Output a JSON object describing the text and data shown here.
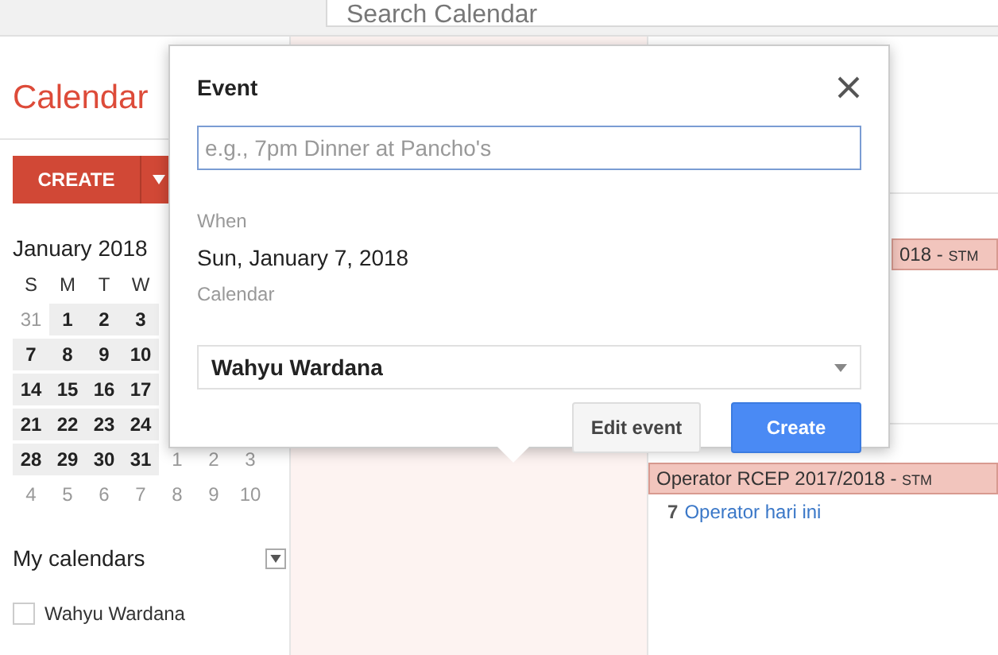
{
  "search": {
    "placeholder": "Search Calendar"
  },
  "sidebar": {
    "title": "Calendar",
    "create_button": "CREATE",
    "mini_calendar": {
      "month": "January 2018",
      "weekdays": [
        "S",
        "M",
        "T",
        "W"
      ],
      "weeks": [
        [
          {
            "day": "31",
            "in_month": false
          },
          {
            "day": "1",
            "in_month": true
          },
          {
            "day": "2",
            "in_month": true
          },
          {
            "day": "3",
            "in_month": true
          }
        ],
        [
          {
            "day": "7",
            "in_month": true
          },
          {
            "day": "8",
            "in_month": true
          },
          {
            "day": "9",
            "in_month": true
          },
          {
            "day": "10",
            "in_month": true
          }
        ],
        [
          {
            "day": "14",
            "in_month": true
          },
          {
            "day": "15",
            "in_month": true
          },
          {
            "day": "16",
            "in_month": true
          },
          {
            "day": "17",
            "in_month": true
          }
        ],
        [
          {
            "day": "21",
            "in_month": true
          },
          {
            "day": "22",
            "in_month": true
          },
          {
            "day": "23",
            "in_month": true
          },
          {
            "day": "24",
            "in_month": true
          }
        ],
        [
          {
            "day": "28",
            "in_month": true
          },
          {
            "day": "29",
            "in_month": true
          },
          {
            "day": "30",
            "in_month": true
          },
          {
            "day": "31",
            "in_month": true
          },
          {
            "day": "1",
            "in_month": false
          },
          {
            "day": "2",
            "in_month": false
          },
          {
            "day": "3",
            "in_month": false
          }
        ],
        [
          {
            "day": "4",
            "in_month": false
          },
          {
            "day": "5",
            "in_month": false
          },
          {
            "day": "6",
            "in_month": false
          },
          {
            "day": "7",
            "in_month": false
          },
          {
            "day": "8",
            "in_month": false
          },
          {
            "day": "9",
            "in_month": false
          },
          {
            "day": "10",
            "in_month": false
          }
        ]
      ]
    },
    "my_calendars": {
      "label": "My calendars",
      "items": [
        {
          "name": "Wahyu Wardana",
          "checked": false
        }
      ]
    }
  },
  "grid": {
    "events": [
      {
        "title": "018 -",
        "tag": "STM"
      },
      {
        "title": "Operator RCEP 2017/2018 -",
        "tag": "STM"
      }
    ],
    "more": {
      "count": "7",
      "label": "Operator hari ini"
    }
  },
  "popup": {
    "title": "Event",
    "placeholder": "e.g., 7pm Dinner at Pancho's",
    "when_label": "When",
    "when": "Sun, January 7, 2018",
    "calendar_label": "Calendar",
    "calendar": "Wahyu Wardana",
    "buttons": [
      {
        "label": "Edit event",
        "kind": "secondary"
      },
      {
        "label": "Create",
        "kind": "primary"
      }
    ]
  }
}
